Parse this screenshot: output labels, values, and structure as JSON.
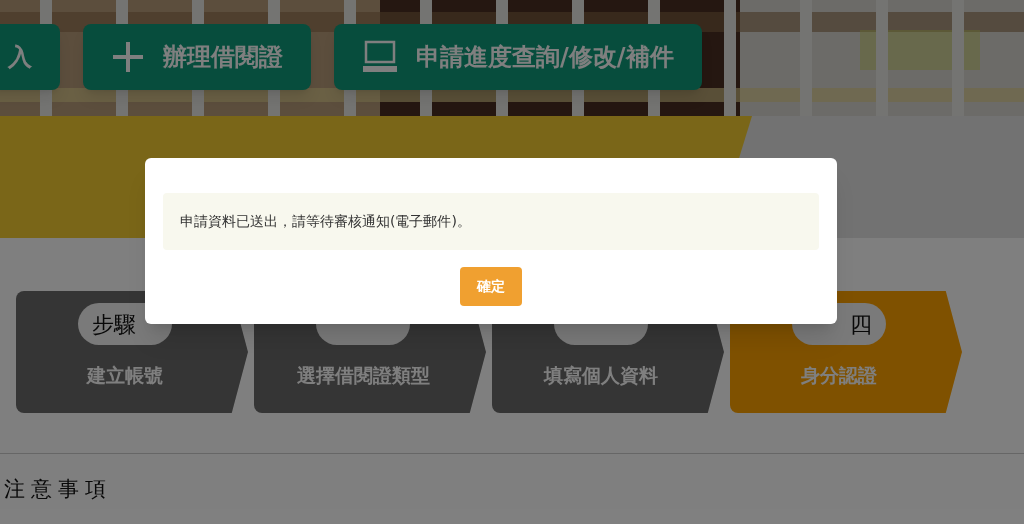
{
  "nav_buttons": [
    {
      "label": "入"
    },
    {
      "label": "辦理借閱證"
    },
    {
      "label": "申請進度查詢/修改/補件"
    }
  ],
  "steps": [
    {
      "step": "步驟",
      "title": "建立帳號",
      "selected": false
    },
    {
      "title": "選擇借閱證類型",
      "selected": false
    },
    {
      "title": "填寫個人資料",
      "selected": false
    },
    {
      "step": "四",
      "title": "身分認證",
      "selected": true
    }
  ],
  "notice_heading": "注意事項",
  "dialog": {
    "message": "申請資料已送出，請等待審核通知(電子郵件)。",
    "button": "確定"
  }
}
